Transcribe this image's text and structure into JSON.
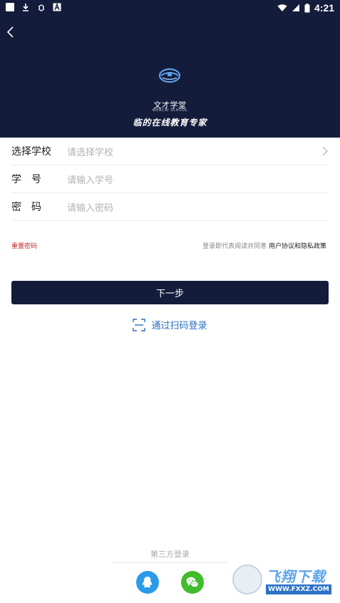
{
  "status_bar": {
    "time": "4:21"
  },
  "header": {
    "brand_cn": "文才学堂",
    "brand_en": "WENCAI SCHOOL",
    "slogan": "临的在线教育专家"
  },
  "form": {
    "school": {
      "label": "选择学校",
      "placeholder": "请选择学校"
    },
    "student_id": {
      "label": "学　号",
      "placeholder": "请输入学号"
    },
    "password": {
      "label": "密　码",
      "placeholder": "请输入密码"
    }
  },
  "links": {
    "reset_password": "重置密码",
    "agree_prefix": "登录即代表阅读并同意",
    "policy": "用户协议和隐私政策"
  },
  "next_button": "下一步",
  "scan_login": "通过扫码登录",
  "third_party": {
    "title": "第三方登录"
  },
  "watermark": {
    "text": "飞翔下载",
    "url": "WWW.FXXZ.COM"
  },
  "colors": {
    "header_bg": "#131c3a",
    "accent_blue": "#2e6fbf",
    "reset_red": "#c0292b",
    "qq_blue": "#2a9bea",
    "wechat_green": "#41bc2c"
  }
}
